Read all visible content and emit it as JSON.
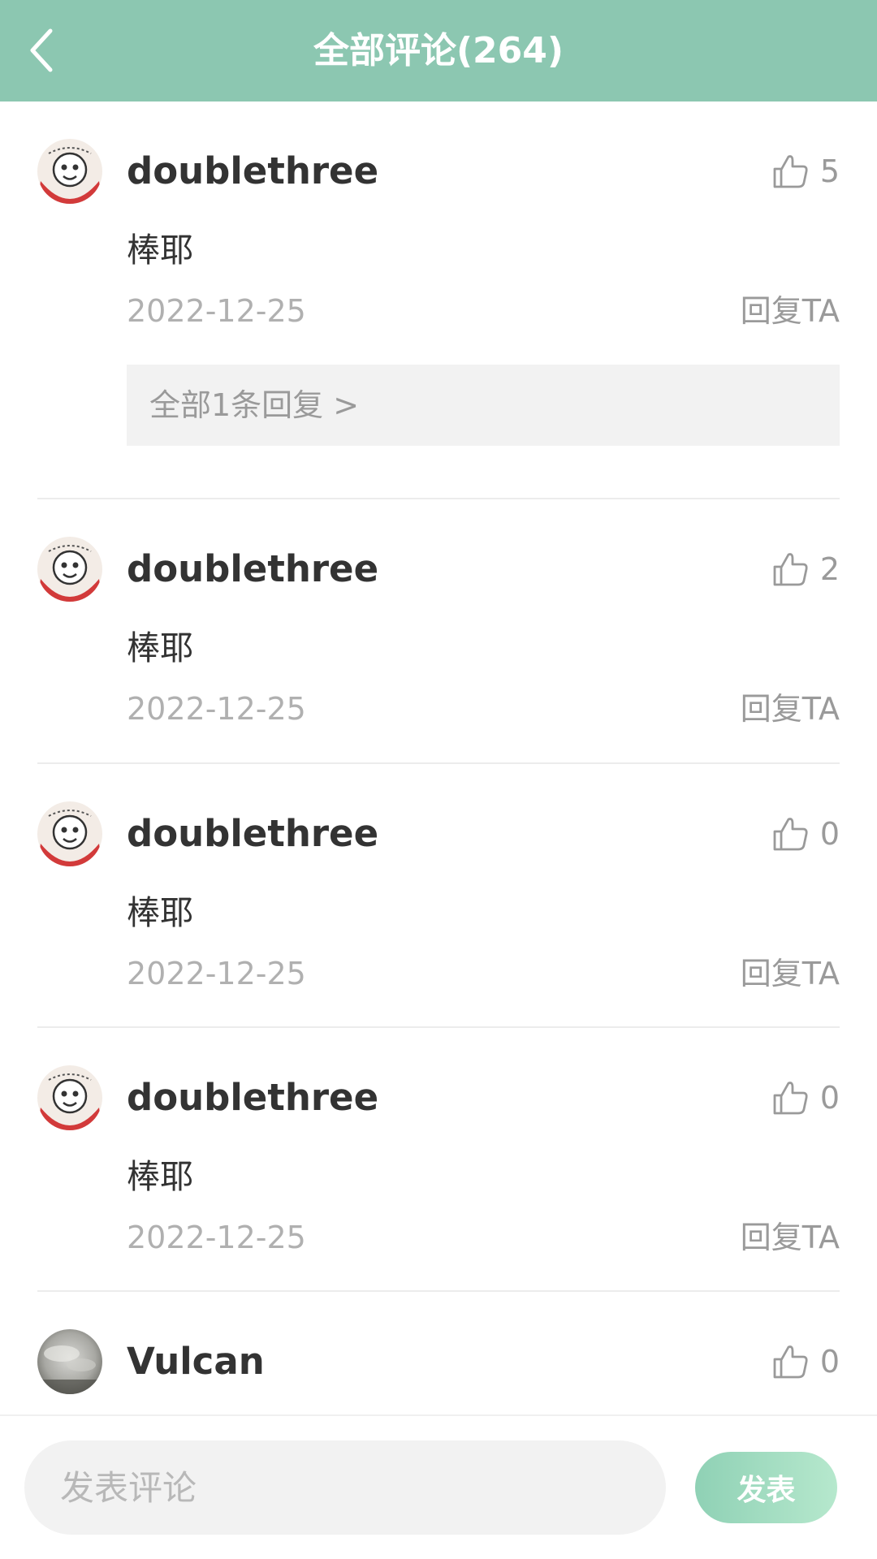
{
  "header": {
    "title": "全部评论(264)",
    "back_icon": "chevron-left-icon",
    "background_color": "#8cc7b1"
  },
  "comments": [
    {
      "username": "doublethree",
      "avatar": "cartoon-avatar",
      "like_icon": "thumbs-up-icon",
      "like_count": "5",
      "content": "棒耶",
      "date": "2022-12-25",
      "reply_label": "回复TA",
      "replies_link": "全部1条回复 >"
    },
    {
      "username": "doublethree",
      "avatar": "cartoon-avatar",
      "like_icon": "thumbs-up-icon",
      "like_count": "2",
      "content": "棒耶",
      "date": "2022-12-25",
      "reply_label": "回复TA"
    },
    {
      "username": "doublethree",
      "avatar": "cartoon-avatar",
      "like_icon": "thumbs-up-icon",
      "like_count": "0",
      "content": "棒耶",
      "date": "2022-12-25",
      "reply_label": "回复TA"
    },
    {
      "username": "doublethree",
      "avatar": "cartoon-avatar",
      "like_icon": "thumbs-up-icon",
      "like_count": "0",
      "content": "棒耶",
      "date": "2022-12-25",
      "reply_label": "回复TA"
    },
    {
      "username": "Vulcan",
      "avatar": "cloud-photo-avatar",
      "like_icon": "thumbs-up-icon",
      "like_count": "0"
    }
  ],
  "composer": {
    "placeholder": "发表评论",
    "value": "",
    "send_label": "发表",
    "send_color": "#a3dcc1"
  }
}
